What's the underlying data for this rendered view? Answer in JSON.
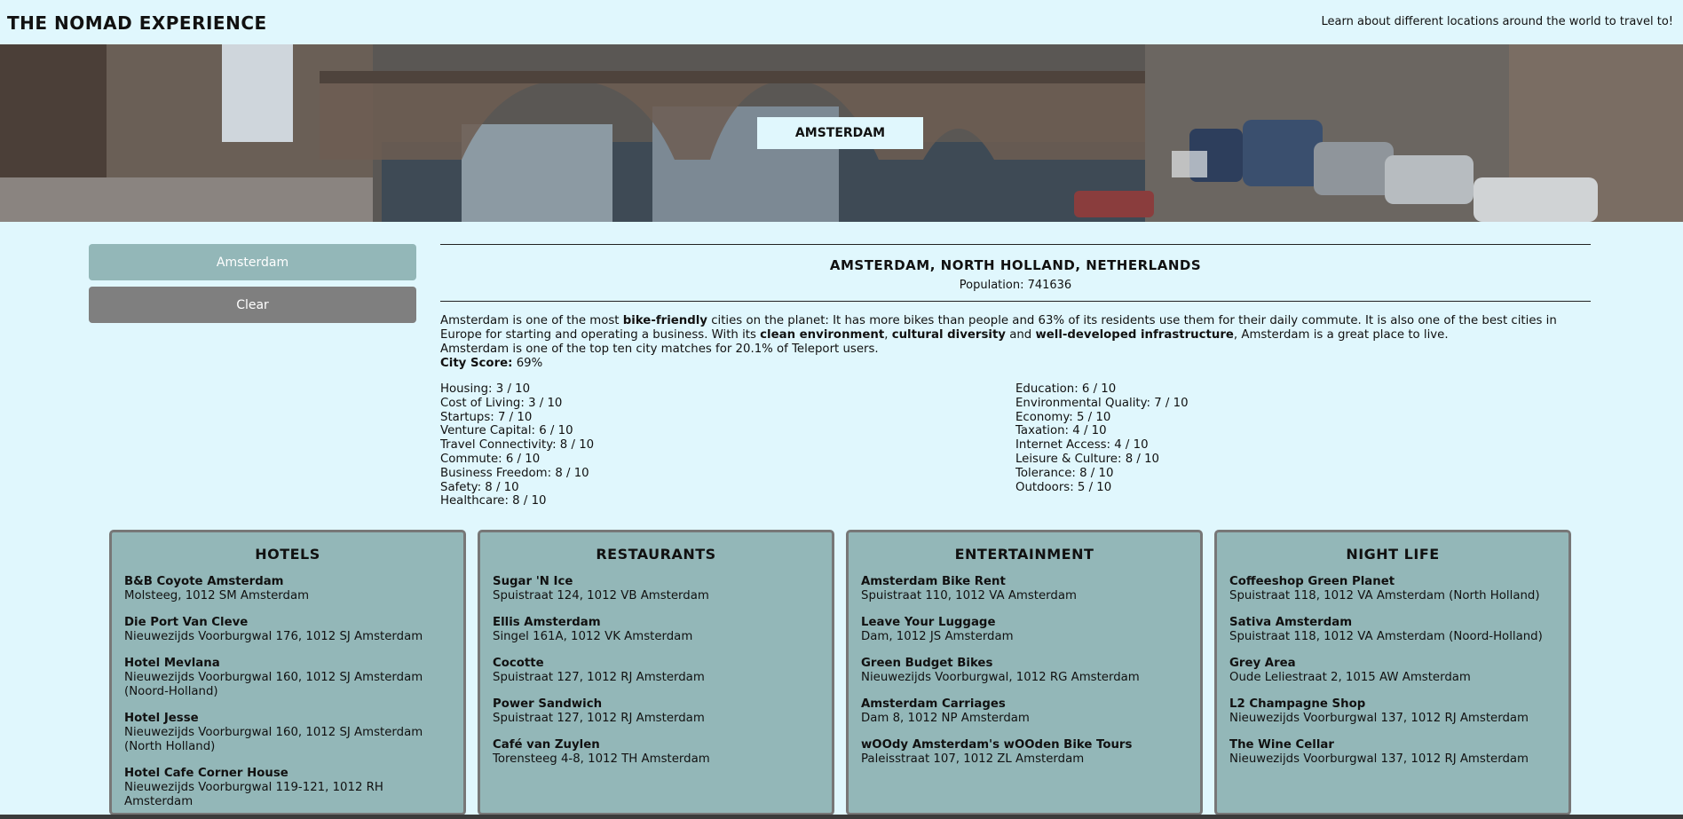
{
  "header": {
    "brand": "THE NOMAD EXPERIENCE",
    "tagline": "Learn about different locations around the world to travel to!"
  },
  "hero": {
    "badge": "AMSTERDAM"
  },
  "sidebar": {
    "city_button": "Amsterdam",
    "clear_button": "Clear"
  },
  "city": {
    "title": "AMSTERDAM, NORTH HOLLAND, NETHERLANDS",
    "population": "Population: 741636",
    "summary": {
      "s1": "Amsterdam is one of the most ",
      "b1": "bike-friendly",
      "s2": " cities on the planet: It has more bikes than people and 63% of its residents use them for their daily commute. It is also one of the best cities in Europe for starting and operating a business. With its ",
      "b2": "clean environment",
      "s3": ", ",
      "b3": "cultural diversity",
      "s4": " and ",
      "b4": "well-developed infrastructure",
      "s5": ", Amsterdam is a great place to live."
    },
    "match": "Amsterdam is one of the top ten city matches for 20.1% of Teleport users.",
    "score_label": "City Score:",
    "score_value": " 69%",
    "scores_left": [
      "Housing: 3 / 10",
      "Cost of Living: 3 / 10",
      "Startups: 7 / 10",
      "Venture Capital: 6 / 10",
      "Travel Connectivity: 8 / 10",
      "Commute: 6 / 10",
      "Business Freedom: 8 / 10",
      "Safety: 8 / 10",
      "Healthcare: 8 / 10"
    ],
    "scores_right": [
      "Education: 6 / 10",
      "Environmental Quality: 7 / 10",
      "Economy: 5 / 10",
      "Taxation: 4 / 10",
      "Internet Access: 4 / 10",
      "Leisure & Culture: 8 / 10",
      "Tolerance: 8 / 10",
      "Outdoors: 5 / 10"
    ]
  },
  "cards": [
    {
      "title": "HOTELS",
      "places": [
        {
          "name": "B&B Coyote Amsterdam",
          "address": "Molsteeg, 1012 SM Amsterdam"
        },
        {
          "name": "Die Port Van Cleve",
          "address": "Nieuwezijds Voorburgwal 176, 1012 SJ Amsterdam"
        },
        {
          "name": "Hotel Mevlana",
          "address": "Nieuwezijds Voorburgwal 160, 1012 SJ Amsterdam (Noord-Holland)"
        },
        {
          "name": "Hotel Jesse",
          "address": "Nieuwezijds Voorburgwal 160, 1012 SJ Amsterdam (North Holland)"
        },
        {
          "name": "Hotel Cafe Corner House",
          "address": "Nieuwezijds Voorburgwal 119-121, 1012 RH Amsterdam"
        }
      ]
    },
    {
      "title": "RESTAURANTS",
      "places": [
        {
          "name": "Sugar 'N Ice",
          "address": "Spuistraat 124, 1012 VB Amsterdam"
        },
        {
          "name": "Ellis Amsterdam",
          "address": "Singel 161A, 1012 VK Amsterdam"
        },
        {
          "name": "Cocotte",
          "address": "Spuistraat 127, 1012 RJ Amsterdam"
        },
        {
          "name": "Power Sandwich",
          "address": "Spuistraat 127, 1012 RJ Amsterdam"
        },
        {
          "name": "Café van Zuylen",
          "address": "Torensteeg 4-8, 1012 TH Amsterdam"
        }
      ]
    },
    {
      "title": "ENTERTAINMENT",
      "places": [
        {
          "name": "Amsterdam Bike Rent",
          "address": "Spuistraat 110, 1012 VA Amsterdam"
        },
        {
          "name": "Leave Your Luggage",
          "address": "Dam, 1012 JS Amsterdam"
        },
        {
          "name": "Green Budget Bikes",
          "address": "Nieuwezijds Voorburgwal, 1012 RG Amsterdam"
        },
        {
          "name": "Amsterdam Carriages",
          "address": "Dam 8, 1012 NP Amsterdam"
        },
        {
          "name": "wOOdy Amsterdam's wOOden Bike Tours",
          "address": "Paleisstraat 107, 1012 ZL Amsterdam"
        }
      ]
    },
    {
      "title": "NIGHT LIFE",
      "places": [
        {
          "name": "Coffeeshop Green Planet",
          "address": "Spuistraat 118, 1012 VA Amsterdam (North Holland)"
        },
        {
          "name": "Sativa Amsterdam",
          "address": "Spuistraat 118, 1012 VA Amsterdam (Noord-Holland)"
        },
        {
          "name": "Grey Area",
          "address": "Oude Leliestraat 2, 1015 AW Amsterdam"
        },
        {
          "name": "L2 Champagne Shop",
          "address": "Nieuwezijds Voorburgwal 137, 1012 RJ Amsterdam"
        },
        {
          "name": "The Wine Cellar",
          "address": "Nieuwezijds Voorburgwal 137, 1012 RJ Amsterdam"
        }
      ]
    }
  ]
}
